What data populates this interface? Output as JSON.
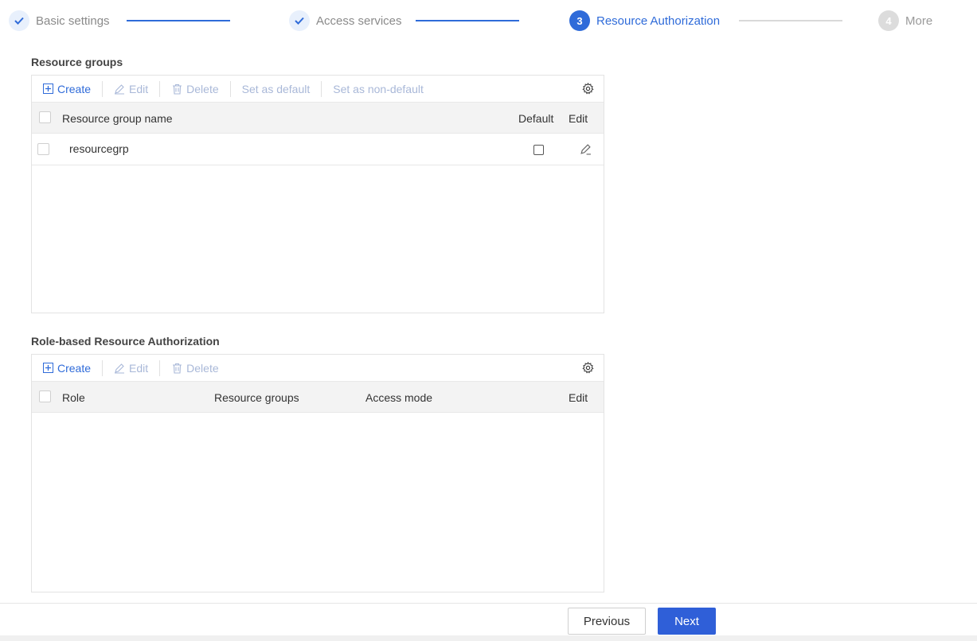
{
  "stepper": {
    "steps": [
      {
        "label": "Basic settings",
        "state": "done",
        "marker": "✓"
      },
      {
        "label": "Access services",
        "state": "done",
        "marker": "✓"
      },
      {
        "label": "Resource Authorization",
        "state": "active",
        "marker": "3"
      },
      {
        "label": "More",
        "state": "todo",
        "marker": "4"
      }
    ]
  },
  "resource_groups": {
    "title": "Resource groups",
    "toolbar": {
      "create": "Create",
      "edit": "Edit",
      "delete": "Delete",
      "set_default": "Set as default",
      "set_non_default": "Set as non-default"
    },
    "columns": {
      "name": "Resource group name",
      "default": "Default",
      "edit": "Edit"
    },
    "rows": [
      {
        "name": "resourcegrp",
        "default": false
      }
    ]
  },
  "role_auth": {
    "title": "Role-based Resource Authorization",
    "toolbar": {
      "create": "Create",
      "edit": "Edit",
      "delete": "Delete"
    },
    "columns": {
      "role": "Role",
      "resource_groups": "Resource groups",
      "access_mode": "Access mode",
      "edit": "Edit"
    },
    "rows": []
  },
  "footer": {
    "previous": "Previous",
    "next": "Next"
  },
  "colors": {
    "accent": "#2f6bd9",
    "button_primary": "#2f5fd8",
    "disabled_text": "#a9b8d8"
  }
}
